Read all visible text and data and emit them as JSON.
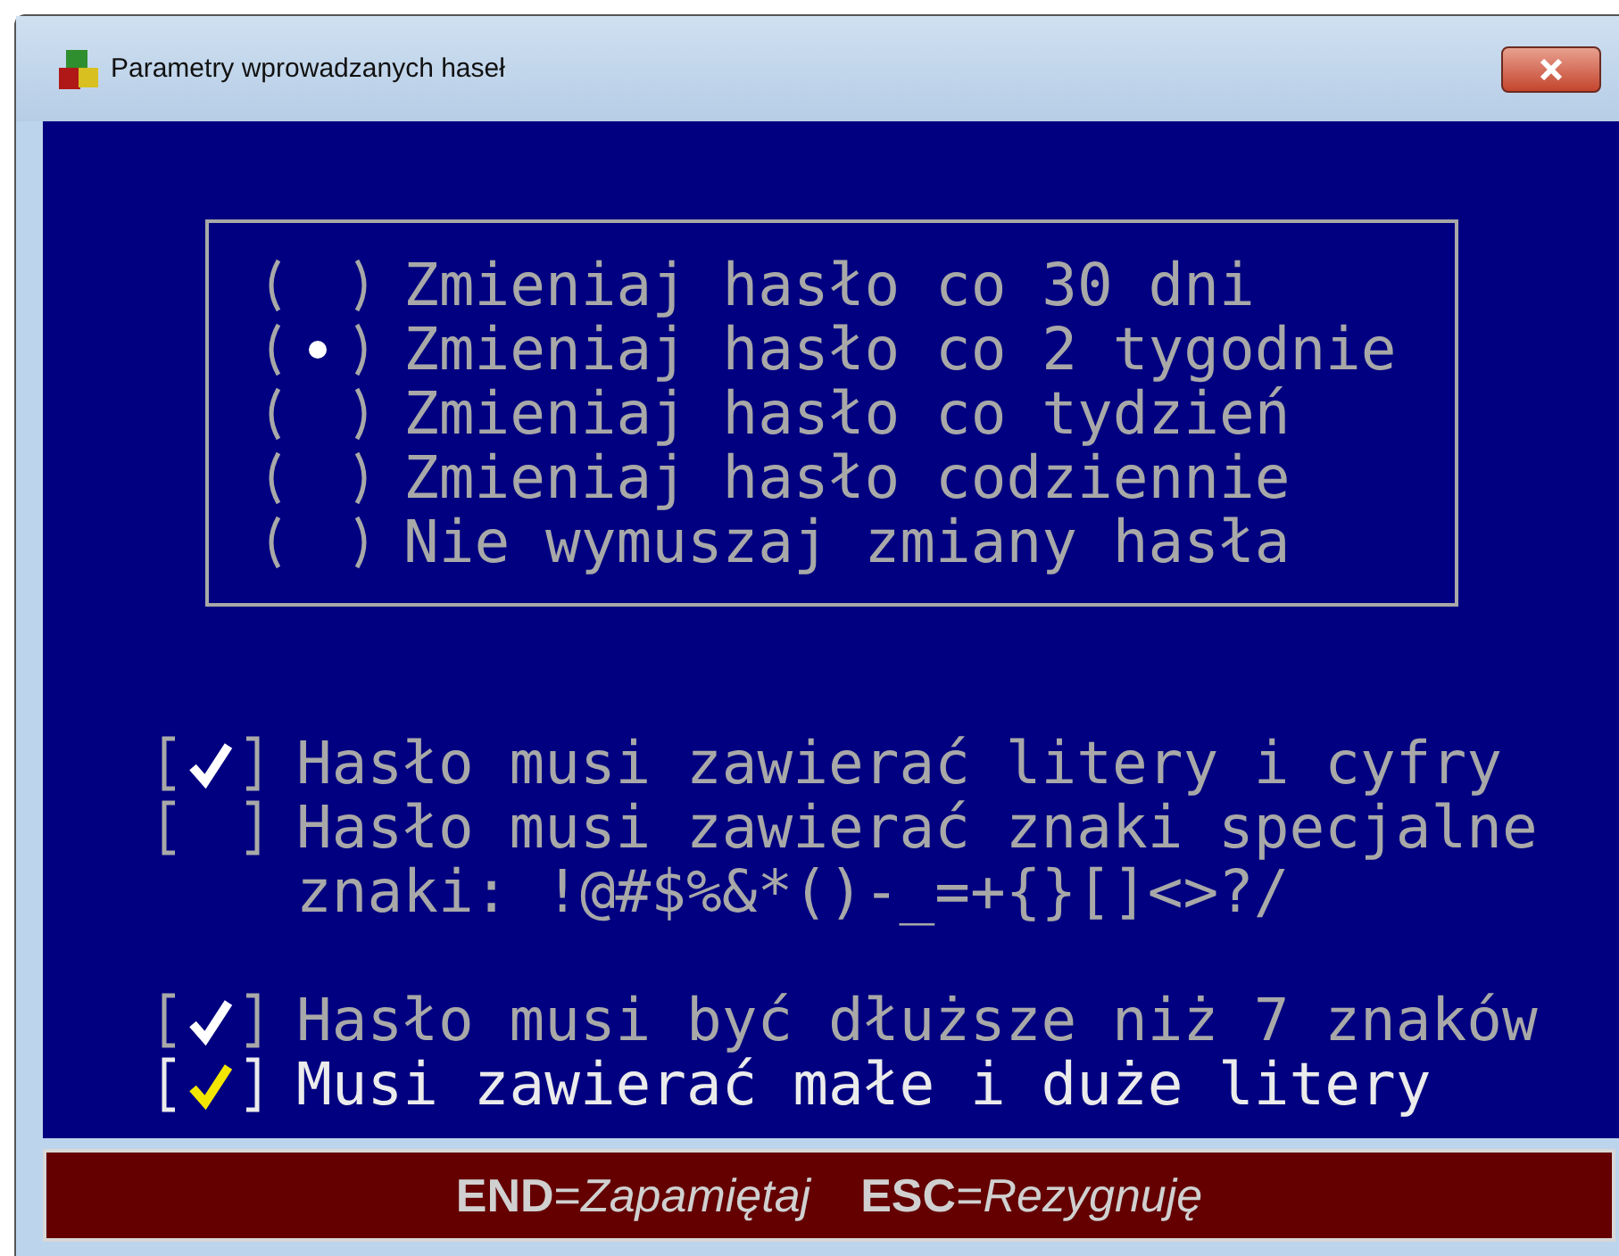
{
  "window": {
    "title": "Parametry wprowadzanych haseł"
  },
  "radio_options": [
    {
      "label": "Zmieniaj hasło co 30 dni",
      "selected": false
    },
    {
      "label": "Zmieniaj hasło co 2 tygodnie",
      "selected": true
    },
    {
      "label": "Zmieniaj hasło co tydzień",
      "selected": false
    },
    {
      "label": "Zmieniaj hasło codziennie",
      "selected": false
    },
    {
      "label": "Nie wymuszaj zmiany hasła",
      "selected": false
    }
  ],
  "checkbox_groups": [
    [
      {
        "label": "Hasło musi zawierać litery i cyfry",
        "checked": true,
        "focused": false
      },
      {
        "label": "Hasło musi zawierać znaki specjalne",
        "checked": false,
        "focused": false,
        "note": "znaki: !@#$%&*()-_=+{}[]<>?/"
      }
    ],
    [
      {
        "label": "Hasło musi być dłuższe niż 7 znaków",
        "checked": true,
        "focused": false
      },
      {
        "label": "Musi zawierać małe i duże litery",
        "checked": true,
        "focused": true
      }
    ]
  ],
  "footer": [
    "**END**=*Zapamiętaj*",
    "**ESC**=*Rezygnuję*"
  ]
}
